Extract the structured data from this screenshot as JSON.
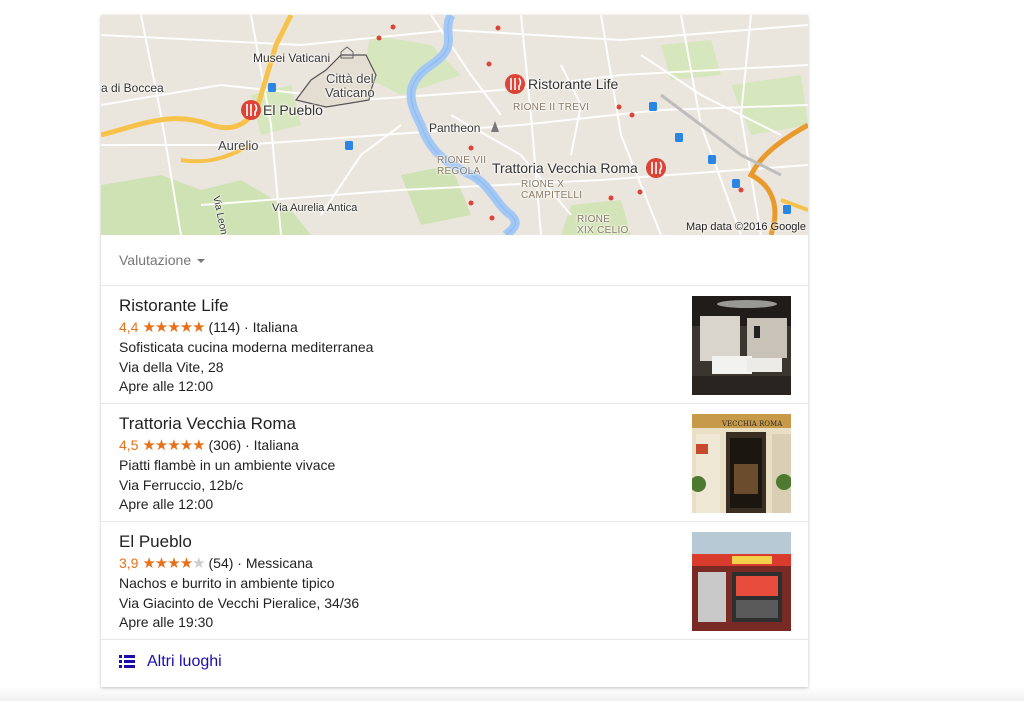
{
  "map": {
    "labels": {
      "musei": "Musei Vaticani",
      "citta": "Città del\nVaticano",
      "boccea": "a di Boccea",
      "aurelio": "Aurelio",
      "pantheon": "Pantheon",
      "rione_trevi": "RIONE II TREVI",
      "rione_regola": "RIONE VII\nREGOLA",
      "rione_campitelli": "RIONE X\nCAMPITELLI",
      "rione_celio": "RIONE\nXIX CELIO",
      "via_aurelia": "Via Aurelia Antica",
      "via_leone": "Via Leone XIII"
    },
    "pins": {
      "life": "Ristorante Life",
      "pueblo": "El Pueblo",
      "vecchia": "Trattoria Vecchia Roma"
    },
    "copyright": "Map data ©2016 Google",
    "colors": {
      "land": "#ebe6dd",
      "park": "#cfe2b4",
      "water": "#a3c8f5",
      "highway": "#f7c24b",
      "rail": "#e99a2c",
      "pin": "#db4437"
    }
  },
  "filter": {
    "label": "Valutazione"
  },
  "results": [
    {
      "name": "Ristorante Life",
      "rating": "4,4",
      "stars": "★★★★★",
      "reviews": "(114)",
      "sep": " · ",
      "cuisine": "Italiana",
      "description": "Sofisticata cucina moderna mediterranea",
      "address": "Via della Vite, 28",
      "hours": "Apre alle 12:00"
    },
    {
      "name": "Trattoria Vecchia Roma",
      "rating": "4,5",
      "stars": "★★★★★",
      "reviews": "(306)",
      "sep": " · ",
      "cuisine": "Italiana",
      "description": "Piatti flambè in un ambiente vivace",
      "address": "Via Ferruccio, 12b/c",
      "hours": "Apre alle 12:00",
      "sign_text": "VECCHIA ROMA"
    },
    {
      "name": "El Pueblo",
      "rating": "3,9",
      "stars_full": "★★★★",
      "stars_empty": "★",
      "reviews": "(54)",
      "sep": " · ",
      "cuisine": "Messicana",
      "description": "Nachos e burrito in ambiente tipico",
      "address": "Via Giacinto de Vecchi Pieralice, 34/36",
      "hours": "Apre alle 19:30"
    }
  ],
  "ratings_values": [
    4.4,
    4.5,
    3.9
  ],
  "more": {
    "label": "Altri luoghi",
    "icon": "list-icon"
  },
  "accent": {
    "star": "#e7711b",
    "link": "#1a0dab"
  }
}
